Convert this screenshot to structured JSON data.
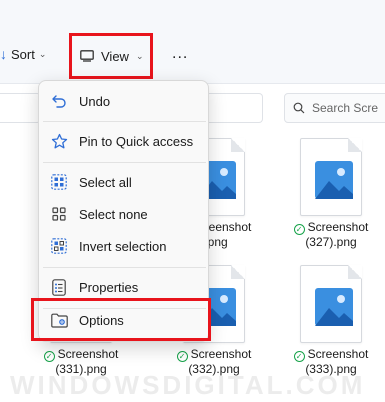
{
  "toolbar": {
    "sort_label": "Sort",
    "view_label": "View",
    "more_label": "..."
  },
  "search": {
    "placeholder": "Search Screenshots",
    "text": "Search Scre"
  },
  "menu": {
    "items": [
      {
        "label": "Undo",
        "icon": "undo-icon"
      },
      {
        "label": "Pin to Quick access",
        "icon": "pin-icon"
      },
      {
        "label": "Select all",
        "icon": "select-all-icon"
      },
      {
        "label": "Select none",
        "icon": "select-none-icon"
      },
      {
        "label": "Invert selection",
        "icon": "invert-selection-icon"
      },
      {
        "label": "Properties",
        "icon": "properties-icon"
      },
      {
        "label": "Options",
        "icon": "options-icon"
      }
    ]
  },
  "files": [
    {
      "line1": "Screenshot",
      "line2": ").png",
      "status": "synced"
    },
    {
      "line1": "Screenshot",
      "line2": "(327).png",
      "status": "synced"
    },
    {
      "line1": "Screenshot",
      "line2": "(331).png",
      "status": "synced"
    },
    {
      "line1": "Screenshot",
      "line2": "(332).png",
      "status": "synced"
    },
    {
      "line1": "Screenshot",
      "line2": "(333).png",
      "status": "synced"
    }
  ],
  "watermark": "WINDOWSDIGITAL.COM",
  "colors": {
    "accent": "#2f6ed6",
    "highlight": "#e8141c",
    "synced": "#17a34a"
  }
}
